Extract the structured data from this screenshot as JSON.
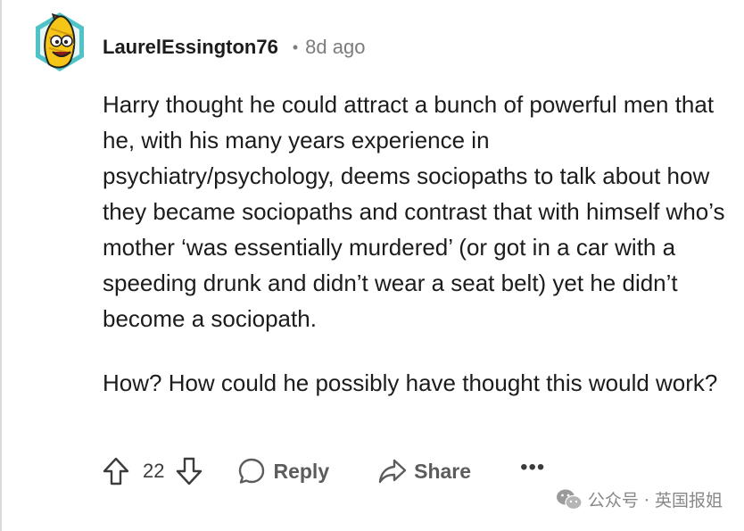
{
  "comment": {
    "author": "LaurelEssington76",
    "separator": "•",
    "timestamp": "8d ago",
    "avatar_icon": "banana-character-avatar-icon",
    "paragraphs": [
      "Harry thought he could attract a bunch of powerful men that he, with his many years experience in psychiatry/psychology, deems sociopaths to talk about how they became sociopaths and contrast that with himself who’s mother ‘was essentially murdered’ (or got in a car with a speeding drunk and didn’t wear a seat belt) yet he didn’t become a sociopath.",
      "How? How could he possibly have thought this would work?"
    ]
  },
  "actions": {
    "upvote_icon": "arrow-up-icon",
    "vote_count": "22",
    "downvote_icon": "arrow-down-icon",
    "reply_label": "Reply",
    "reply_icon": "speech-bubble-icon",
    "share_label": "Share",
    "share_icon": "share-arrow-icon",
    "more_label": "•••"
  },
  "watermark": {
    "text": "公众号 · 英国报姐",
    "icon": "wechat-icon"
  },
  "colors": {
    "text": "#1c1c1c",
    "meta": "#7c7c7c",
    "action": "#5c5c5c",
    "avatar_bg": "#4fc3c7",
    "avatar_banana": "#f5c518"
  }
}
